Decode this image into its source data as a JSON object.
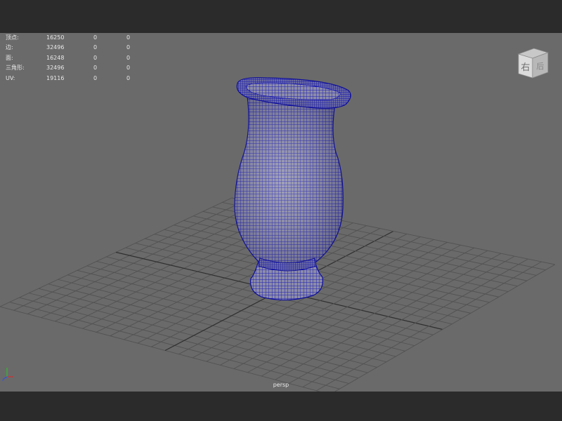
{
  "hud": {
    "rows": [
      {
        "label": "顶点:",
        "total": "16250",
        "selected": "0",
        "components": "0"
      },
      {
        "label": "边:",
        "total": "32496",
        "selected": "0",
        "components": "0"
      },
      {
        "label": "面:",
        "total": "16248",
        "selected": "0",
        "components": "0"
      },
      {
        "label": "三角形:",
        "total": "32496",
        "selected": "0",
        "components": "0"
      },
      {
        "label": "UV:",
        "total": "19116",
        "selected": "0",
        "components": "0"
      }
    ]
  },
  "camera": {
    "name": "persp"
  },
  "view_cube": {
    "face_front": "右",
    "face_side": "后"
  },
  "colors": {
    "viewport_bg": "#6a6a6a",
    "grid": "#525252",
    "grid_axis": "#2f2f2f",
    "wireframe": "#1a1ab4",
    "mesh_fill": "#8a8aa8"
  },
  "icons": {
    "view_cube": "view-cube-icon",
    "axis": "axis-gizmo-icon"
  }
}
